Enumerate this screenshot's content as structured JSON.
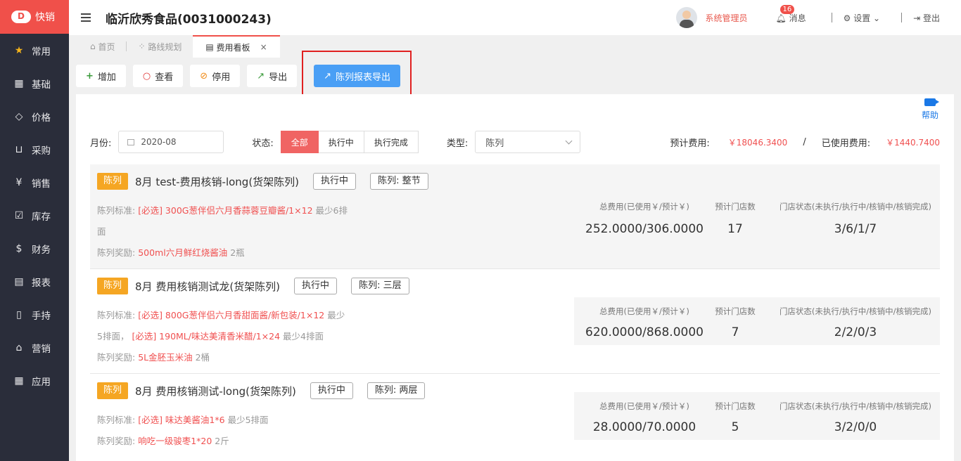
{
  "app": {
    "name": "快销"
  },
  "sidebar": {
    "items": [
      {
        "label": "常用",
        "icon": "star-icon"
      },
      {
        "label": "基础",
        "icon": "grid-icon"
      },
      {
        "label": "价格",
        "icon": "tag-icon"
      },
      {
        "label": "采购",
        "icon": "cart-icon"
      },
      {
        "label": "销售",
        "icon": "yen-icon"
      },
      {
        "label": "库存",
        "icon": "checkbox-icon"
      },
      {
        "label": "财务",
        "icon": "money-bag-icon"
      },
      {
        "label": "报表",
        "icon": "report-icon"
      },
      {
        "label": "手持",
        "icon": "handheld-icon"
      },
      {
        "label": "营销",
        "icon": "store-icon"
      },
      {
        "label": "应用",
        "icon": "apps-icon"
      }
    ]
  },
  "header": {
    "company": "临沂欣秀食品(0031000243)",
    "user": "系统管理员",
    "messages_label": "消息",
    "messages_count": "16",
    "settings_label": "设置",
    "logout_label": "登出"
  },
  "tabs": [
    {
      "label": "首页"
    },
    {
      "label": "路线规划"
    },
    {
      "label": "费用看板",
      "close": "×"
    }
  ],
  "toolbar": {
    "add": "增加",
    "view": "查看",
    "disable": "停用",
    "export": "导出",
    "display_export": "陈列报表导出"
  },
  "help_label": "帮助",
  "filters": {
    "month_label": "月份:",
    "month_value": "2020-08",
    "status_label": "状态:",
    "status_options": [
      "全部",
      "执行中",
      "执行完成"
    ],
    "type_label": "类型:",
    "type_value": "陈列",
    "expected_label": "预计费用:",
    "expected_value": "￥18046.3400",
    "slash": "/",
    "used_label": "已使用费用:",
    "used_value": "￥1440.7400"
  },
  "stat_headers": {
    "total": "总费用(已使用￥/预计￥)",
    "stores": "预计门店数",
    "status": "门店状态(未执行/执行中/核销中/核销完成)"
  },
  "cards": [
    {
      "type": "陈列",
      "title": "8月 test-费用核销-long(货架陈列)",
      "status": "执行中",
      "display": "陈列: 整节",
      "std_label": "陈列标准:",
      "std_red": "[必选] 300G葱伴侣六月香蒜蓉豆瓣酱/1×12",
      "std_tail": "最少6排",
      "std_line2": "面",
      "reward_label": "陈列奖励:",
      "reward_red": "500ml六月鲜红烧酱油",
      "reward_tail": "2瓶",
      "total": "252.0000/306.0000",
      "stores": "17",
      "store_status": "3/6/1/7"
    },
    {
      "type": "陈列",
      "title": "8月 费用核销测试龙(货架陈列)",
      "status": "执行中",
      "display": "陈列: 三层",
      "std_label": "陈列标准:",
      "std_red": "[必选] 800G葱伴侣六月香甜面酱/新包装/1×12",
      "std_tail": "最少",
      "std_line2_a": "5排面，",
      "std_line2_red": "[必选] 190ML/味达美清香米醋/1×24",
      "std_line2_b": "最少4排面",
      "reward_label": "陈列奖励:",
      "reward_red": "5L金胚玉米油",
      "reward_tail": "2桶",
      "total": "620.0000/868.0000",
      "stores": "7",
      "store_status": "2/2/0/3"
    },
    {
      "type": "陈列",
      "title": "8月 费用核销测试-long(货架陈列)",
      "status": "执行中",
      "display": "陈列: 两层",
      "std_label": "陈列标准:",
      "std_red": "[必选] 味达美酱油1*6",
      "std_tail": "最少5排面",
      "reward_label": "陈列奖励:",
      "reward_red": "响吃一级骏枣1*20",
      "reward_tail": "2斤",
      "total": "28.0000/70.0000",
      "stores": "5",
      "store_status": "3/2/0/0"
    }
  ]
}
